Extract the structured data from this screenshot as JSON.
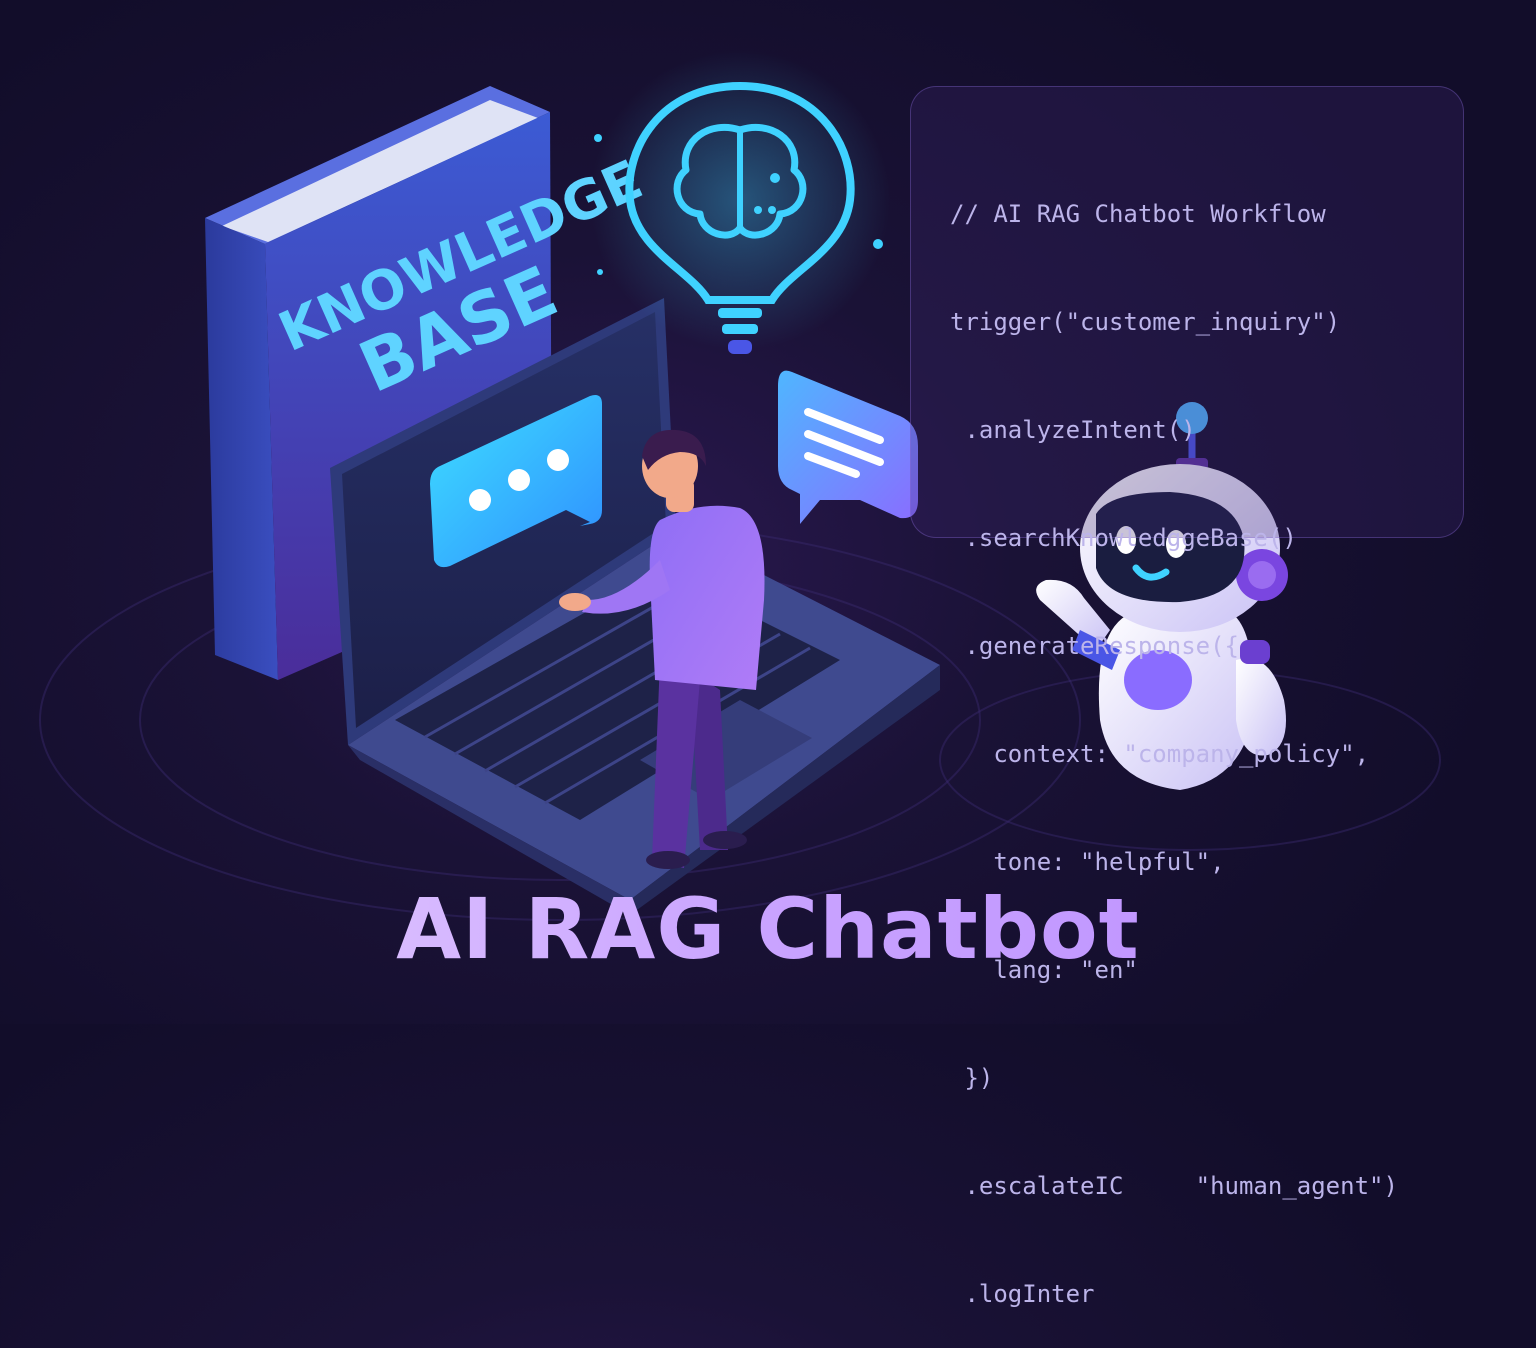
{
  "title": "AI RAG Chatbot",
  "book": {
    "line1": "KNOWLEDGE",
    "line2": "BASE"
  },
  "code": {
    "lines": [
      "// AI RAG Chatbot Workflow",
      "trigger(\"customer_inquiry\")",
      " .analyzeIntent()",
      " .searchKnowledggeBase()",
      " .generateResponse({",
      "   context: \"company_policy\",",
      "   tone: \"helpful\",",
      "   lang: \"en\"",
      " })",
      " .escalateIC     \"human_agent\")",
      " .logInter"
    ]
  },
  "icons": {
    "brain_bulb": "lightbulb-brain-icon",
    "chat_typing": "chat-typing-icon",
    "chat_lines": "chat-message-icon",
    "robot": "robot-mascot",
    "person": "user-figure",
    "laptop": "laptop"
  },
  "colors": {
    "background": "#1a1236",
    "title": "#d8b4ff",
    "book": "#3b4fc4",
    "book_text": "#5fd3ff",
    "code_text": "#bcb4ea",
    "cyan_glow": "#3fd2ff",
    "robot_body": "#ece8ff",
    "robot_accent": "#8b5cf6",
    "person_shirt": "#9a6cf0"
  }
}
